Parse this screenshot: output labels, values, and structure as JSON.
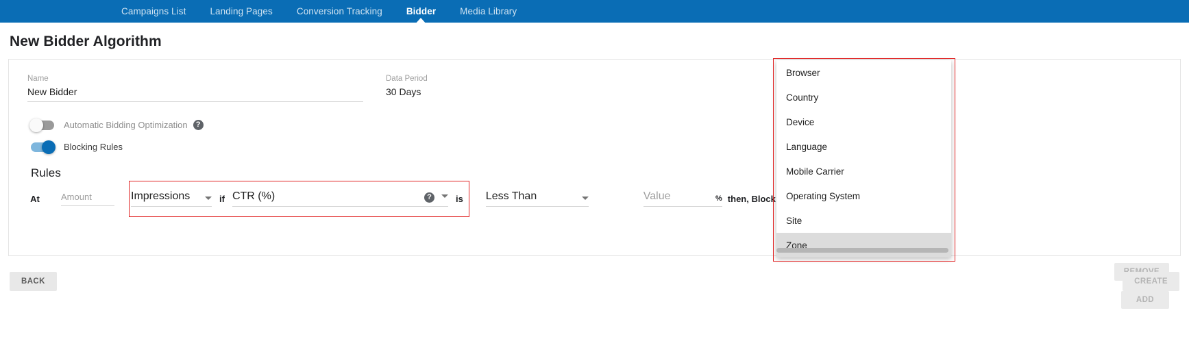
{
  "navbar": {
    "items": [
      {
        "label": "Campaigns List",
        "active": false
      },
      {
        "label": "Landing Pages",
        "active": false
      },
      {
        "label": "Conversion Tracking",
        "active": false
      },
      {
        "label": "Bidder",
        "active": true
      },
      {
        "label": "Media Library",
        "active": false
      }
    ],
    "background_color": "#0a6db5"
  },
  "page": {
    "title": "New Bidder Algorithm"
  },
  "form": {
    "name_label": "Name",
    "name_value": "New Bidder",
    "data_period_label": "Data Period",
    "data_period_value": "30 Days"
  },
  "toggles": {
    "automatic_bidding": {
      "label": "Automatic Bidding Optimization",
      "state": "off",
      "help_icon": "question-mark-icon",
      "help_glyph": "?"
    },
    "blocking_rules": {
      "label": "Blocking Rules",
      "state": "on"
    }
  },
  "rules": {
    "section_title": "Rules",
    "at_label": "At",
    "amount_placeholder": "Amount",
    "metric_value": "Impressions",
    "if_label": "if",
    "condition_field_value": "CTR (%)",
    "condition_help_glyph": "?",
    "is_label": "is",
    "operator_value": "Less Than",
    "value_placeholder": "Value",
    "percent_symbol": "%",
    "then_label": "then, Block",
    "remove_button": "REMOVE",
    "add_button": "ADD",
    "highlight_color": "#e02020"
  },
  "footer": {
    "back_button": "BACK",
    "create_button": "CREATE"
  },
  "dropdown": {
    "items": [
      {
        "label": "Browser",
        "highlighted": false
      },
      {
        "label": "Country",
        "highlighted": false
      },
      {
        "label": "Device",
        "highlighted": false
      },
      {
        "label": "Language",
        "highlighted": false
      },
      {
        "label": "Mobile Carrier",
        "highlighted": false
      },
      {
        "label": "Operating System",
        "highlighted": false
      },
      {
        "label": "Site",
        "highlighted": false
      },
      {
        "label": "Zone",
        "highlighted": true
      }
    ],
    "highlight_border_color": "#e02020"
  }
}
